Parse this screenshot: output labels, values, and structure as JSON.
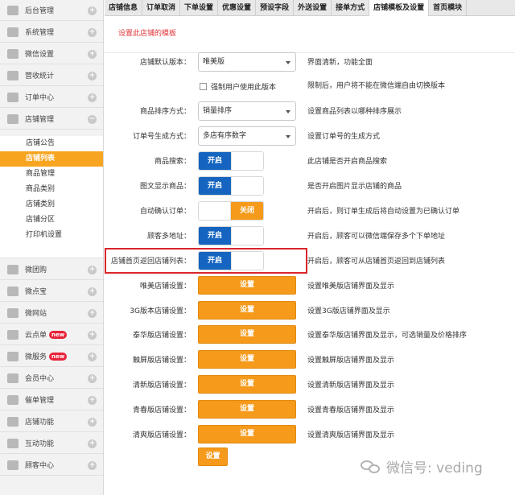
{
  "sidebar": {
    "items": [
      {
        "label": "后台管理",
        "icon": "home-icon"
      },
      {
        "label": "系统管理",
        "icon": "grid-icon"
      },
      {
        "label": "微信设置",
        "icon": "mail-icon"
      },
      {
        "label": "营收统计",
        "icon": "pie-chart-icon"
      },
      {
        "label": "订单中心",
        "icon": "cart-icon"
      },
      {
        "label": "店铺管理",
        "icon": "pie-chart-icon"
      }
    ],
    "sub_items": [
      {
        "label": "店铺公告"
      },
      {
        "label": "店铺列表"
      },
      {
        "label": "商品管理"
      },
      {
        "label": "商品类别"
      },
      {
        "label": "店铺类别"
      },
      {
        "label": "店铺分区"
      },
      {
        "label": "打印机设置"
      }
    ],
    "lower_items": [
      {
        "label": "微团购",
        "icon": "grid-icon"
      },
      {
        "label": "微点宝",
        "icon": "grid-icon"
      },
      {
        "label": "微网站",
        "icon": "grid-icon"
      },
      {
        "label": "云点单",
        "icon": "grid-icon",
        "badge": "new"
      },
      {
        "label": "微服务",
        "icon": "grid-icon",
        "badge": "new"
      },
      {
        "label": "会员中心",
        "icon": "pie-chart-icon"
      },
      {
        "label": "催单管理",
        "icon": "printer-icon"
      },
      {
        "label": "店铺功能",
        "icon": "plus-icon"
      },
      {
        "label": "互动功能",
        "icon": "plus-icon"
      },
      {
        "label": "顾客中心",
        "icon": "folder-icon"
      }
    ]
  },
  "tabs": [
    {
      "label": "店铺信息"
    },
    {
      "label": "订单取消"
    },
    {
      "label": "下单设置"
    },
    {
      "label": "优惠设置"
    },
    {
      "label": "预设字段"
    },
    {
      "label": "外送设置"
    },
    {
      "label": "接单方式"
    },
    {
      "label": "店铺模板及设置"
    },
    {
      "label": "首页模块"
    }
  ],
  "main": {
    "set_link": "设置此店铺的模板",
    "version": {
      "label": "店铺默认版本：",
      "value": "唯美版",
      "hint": "界面清新，功能全面"
    },
    "force": {
      "label": "强制用户使用此版本",
      "hint": "限制后，用户将不能在微信端自由切换版本"
    },
    "sort": {
      "label": "商品排序方式：",
      "value": "销量排序",
      "hint": "设置商品列表以哪种排序展示"
    },
    "order_no": {
      "label": "订单号生成方式：",
      "value": "多店有序数字",
      "hint": "设置订单号的生成方式"
    },
    "toggles": [
      {
        "label": "商品搜索：",
        "state": "开启",
        "on": true,
        "hint": "此店铺是否开启商品搜索"
      },
      {
        "label": "图文显示商品：",
        "state": "开启",
        "on": true,
        "hint": "是否开启图片显示店铺的商品"
      },
      {
        "label": "自动确认订单：",
        "state": "关闭",
        "on": false,
        "hint": "开启后，则订单生成后将自动设置为已确认订单"
      },
      {
        "label": "顾客多地址：",
        "state": "开启",
        "on": true,
        "hint": "开启后，顾客可以微信端保存多个下单地址"
      },
      {
        "label": "店铺首页返回店铺列表：",
        "state": "开启",
        "on": true,
        "hint": "开启后，顾客可从店铺首页返回到店铺列表"
      }
    ],
    "templates": [
      {
        "label": "唯美店铺设置：",
        "button": "设置",
        "hint": "设置唯美版店铺界面及显示"
      },
      {
        "label": "3G版本店铺设置：",
        "button": "设置",
        "hint": "设置3G版店铺界面及显示"
      },
      {
        "label": "泰华版店铺设置：",
        "button": "设置",
        "hint": "设置泰华版店铺界面及显示，可选销量及价格排序"
      },
      {
        "label": "触屏版店铺设置：",
        "button": "设置",
        "hint": "设置触屏版店铺界面及显示"
      },
      {
        "label": "清新版店铺设置：",
        "button": "设置",
        "hint": "设置清新版店铺界面及显示"
      },
      {
        "label": "青春版店铺设置：",
        "button": "设置",
        "hint": "设置青春版店铺界面及显示"
      },
      {
        "label": "清爽版店铺设置：",
        "button": "设置",
        "hint": "设置清爽版店铺界面及显示"
      }
    ],
    "final_button": "设置"
  },
  "watermark": "微信号: veding",
  "colors": {
    "accent": "#f59a1b",
    "toggle_on": "#1565c0",
    "link": "#e0353a",
    "highlight": "#d9262b"
  }
}
